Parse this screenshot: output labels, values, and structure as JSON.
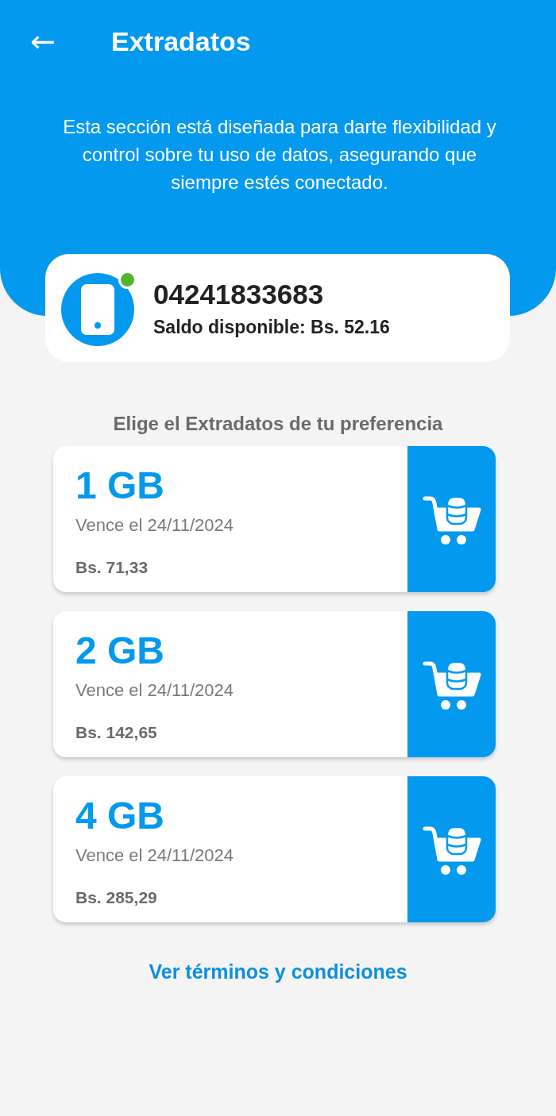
{
  "header": {
    "back_icon": "←",
    "title": "Extradatos",
    "description": "Esta sección está diseñada para darte flexibilidad y control sobre tu uso de datos, asegurando que siempre estés conectado."
  },
  "account": {
    "number": "04241833683",
    "balance": "Saldo disponible: Bs. 52.16",
    "online": true
  },
  "plans_heading": "Elige el Extradatos de tu preferencia",
  "plans": [
    {
      "size": "1 GB",
      "expiry": "Vence el 24/11/2024",
      "price": "Bs. 71,33"
    },
    {
      "size": "2 GB",
      "expiry": "Vence el 24/11/2024",
      "price": "Bs. 142,65"
    },
    {
      "size": "4 GB",
      "expiry": "Vence el 24/11/2024",
      "price": "Bs. 285,29"
    }
  ],
  "terms_link": "Ver términos y condiciones"
}
